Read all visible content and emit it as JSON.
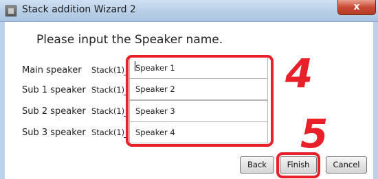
{
  "window": {
    "title": "Stack addition Wizard 2",
    "close_label": "x"
  },
  "heading": "Please input the Speaker name.",
  "rows": [
    {
      "label": "Main speaker",
      "stack": "Stack(1)",
      "value": "Speaker 1"
    },
    {
      "label": "Sub 1 speaker",
      "stack": "Stack(1)",
      "value": "Speaker 2"
    },
    {
      "label": "Sub 2 speaker",
      "stack": "Stack(1)",
      "value": "Speaker 3"
    },
    {
      "label": "Sub 3 speaker",
      "stack": "Stack(1)",
      "value": "Speaker 4"
    }
  ],
  "annotations": {
    "step_names": "4",
    "step_finish": "5",
    "color": "#e8202a"
  },
  "buttons": {
    "back": "Back",
    "finish": "Finish",
    "cancel": "Cancel"
  }
}
